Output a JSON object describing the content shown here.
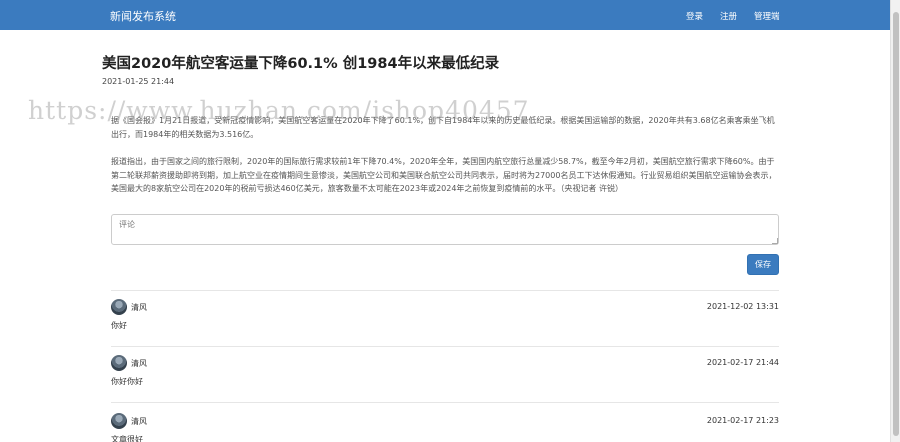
{
  "navbar": {
    "brand": "新闻发布系统",
    "links": [
      "登录",
      "注册",
      "管理端"
    ]
  },
  "article": {
    "title": "美国2020年航空客运量下降60.1% 创1984年以来最低纪录",
    "date": "2021-01-25 21:44",
    "paragraphs": [
      "据《国会报》1月21日报道，受新冠疫情影响，美国航空客运量在2020年下降了60.1%，创下自1984年以来的历史最低纪录。根据美国运输部的数据，2020年共有3.68亿名乘客乘坐飞机出行，而1984年的相关数据为3.516亿。",
      "报道指出，由于国家之间的旅行限制，2020年的国际旅行需求较前1年下降70.4%，2020年全年，美国国内航空旅行总量减少58.7%，截至今年2月初，美国航空旅行需求下降60%。由于第二轮联邦薪资援助即将到期，加上航空业在疫情期间生意惨淡，美国航空公司和美国联合航空公司共同表示，届时将为27000名员工下达休假通知。行业贸易组织美国航空运输协会表示，美国最大的8家航空公司在2020年的税前亏损达460亿美元，旅客数量不太可能在2023年或2024年之前恢复到疫情前的水平。（央视记者 许锐）"
    ]
  },
  "watermark": "https://www.huzhan.com/ishop40457",
  "comment_form": {
    "placeholder": "评论",
    "save_label": "保存"
  },
  "comments": [
    {
      "user": "清风",
      "time": "2021-12-02 13:31",
      "text": "你好"
    },
    {
      "user": "清风",
      "time": "2021-02-17 21:44",
      "text": "你好你好"
    },
    {
      "user": "清风",
      "time": "2021-02-17 21:23",
      "text": "文章很好"
    }
  ],
  "colors": {
    "navbar": "#3b7bbf",
    "button": "#3b7bbf"
  }
}
